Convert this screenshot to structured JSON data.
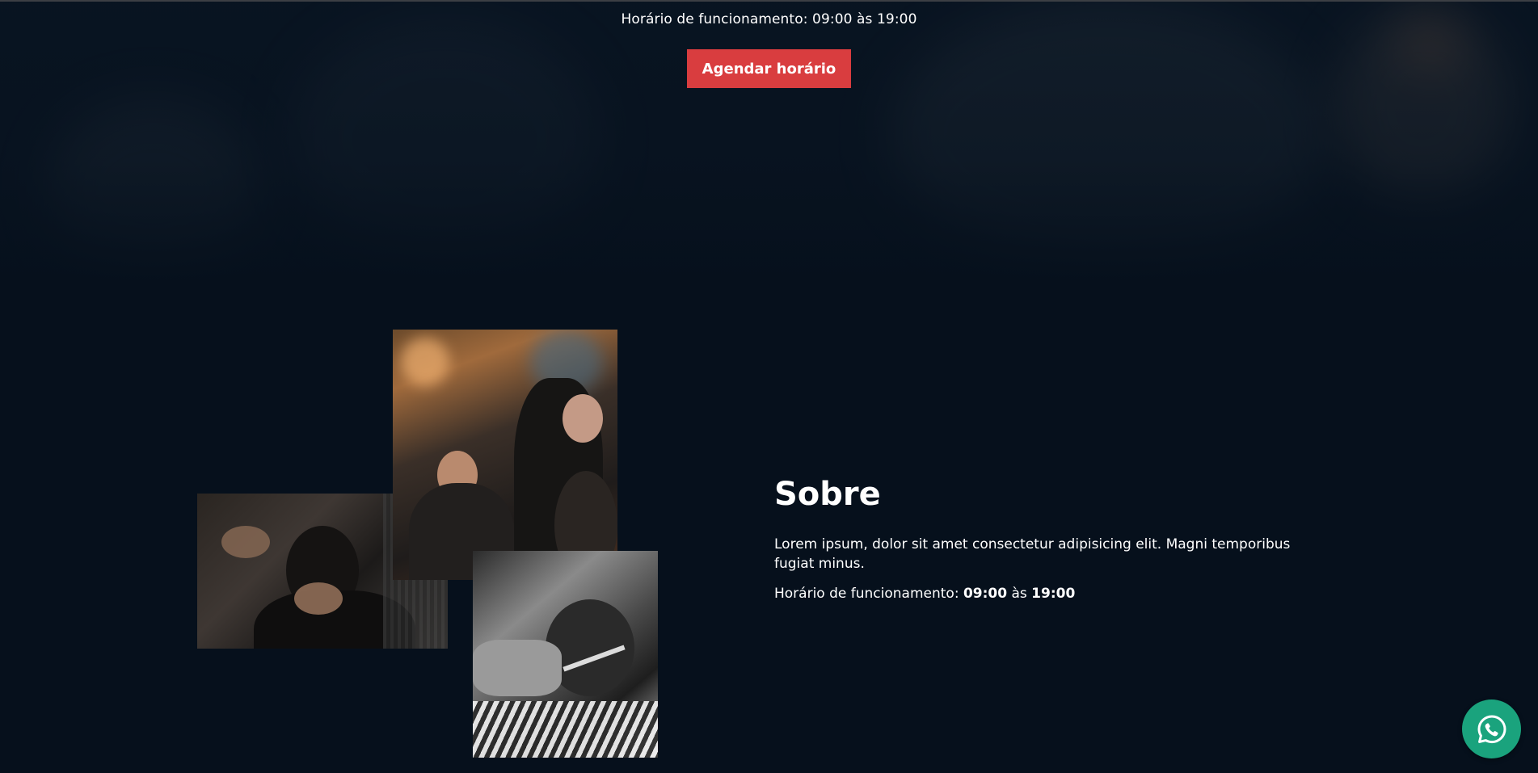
{
  "hero": {
    "hours_text": "Horário de funcionamento: 09:00 às 19:00",
    "cta_label": "Agendar horário"
  },
  "about": {
    "title": "Sobre",
    "description": "Lorem ipsum, dolor sit amet consectetur adipisicing elit. Magni temporibus fugiat minus.",
    "hours_label": "Horário de funcionamento:",
    "hours_open": "09:00",
    "hours_separator": "às",
    "hours_close": "19:00"
  },
  "colors": {
    "background": "#06101c",
    "accent": "#d93d3f",
    "whatsapp": "#1aa37d"
  },
  "icons": {
    "floating": "whatsapp-icon"
  }
}
